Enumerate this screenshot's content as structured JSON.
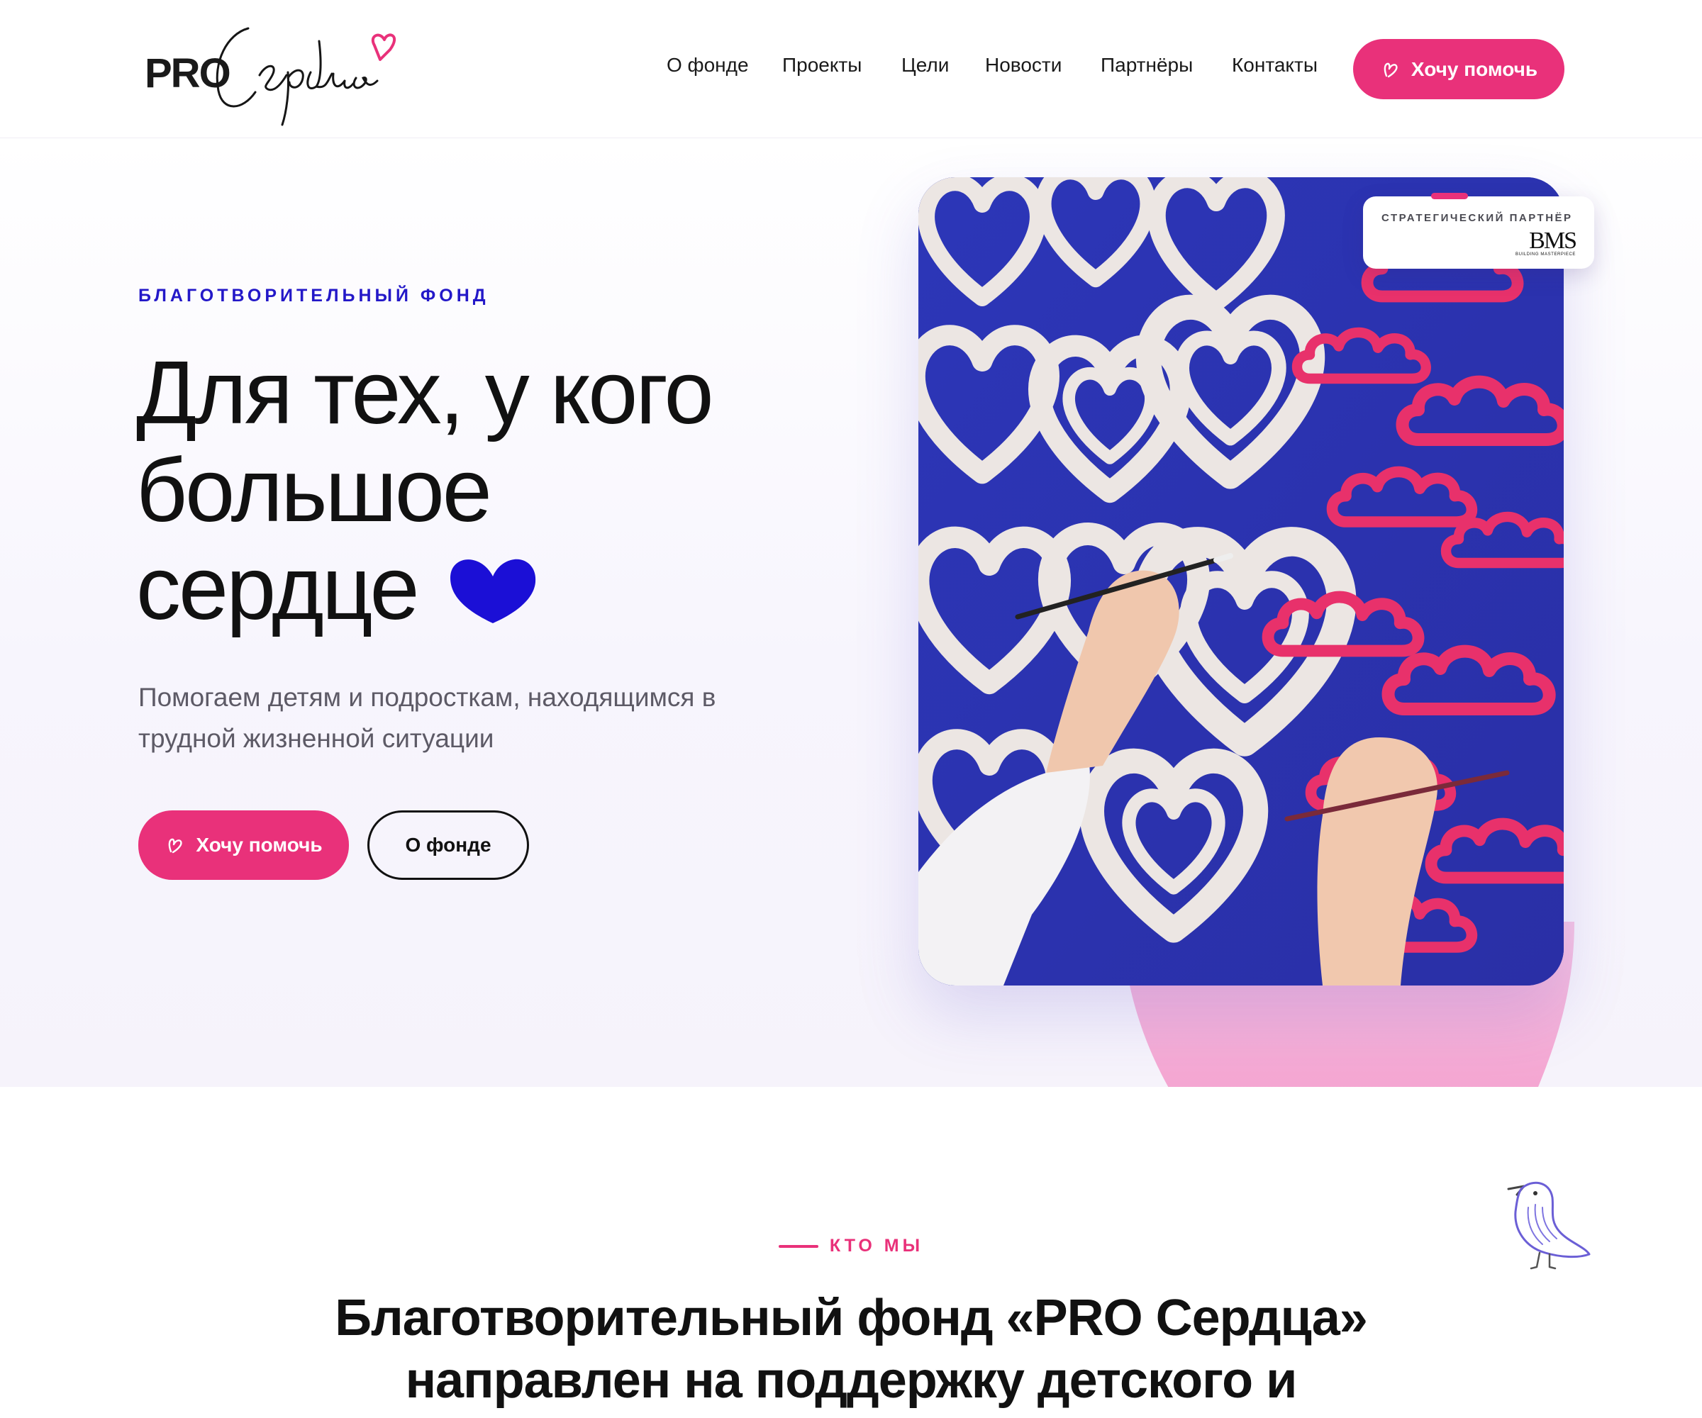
{
  "header": {
    "logo": {
      "pro": "PRO",
      "script": "Сердца"
    },
    "nav": [
      "О фонде",
      "Проекты",
      "Цели",
      "Новости",
      "Партнёры",
      "Контакты"
    ],
    "help_button": "Хочу помочь"
  },
  "hero": {
    "eyebrow": "БЛАГОТВОРИТЕЛЬНЫЙ ФОНД",
    "headline_lines": [
      "Для тех, у кого",
      "большое",
      "сердце"
    ],
    "subtitle_lines": [
      "Помогаем детям и подросткам, находящимся в",
      "трудной жизненной ситуации"
    ],
    "primary_button": "Хочу помочь",
    "secondary_button": "О фонде",
    "partner": {
      "label": "СТРАТЕГИЧЕСКИЙ ПАРТНЁР",
      "logo": "BMS",
      "logo_sub": "BUILDING MASTERPIECE"
    }
  },
  "who": {
    "eyebrow": "КТО МЫ",
    "title_lines": [
      "Благотворительный фонд «PRO Сердца»",
      "направлен на поддержку детского и"
    ]
  },
  "colors": {
    "accent": "#e9317a",
    "brand_blue": "#2318c8",
    "text": "#111111",
    "muted": "#5d5a66"
  }
}
